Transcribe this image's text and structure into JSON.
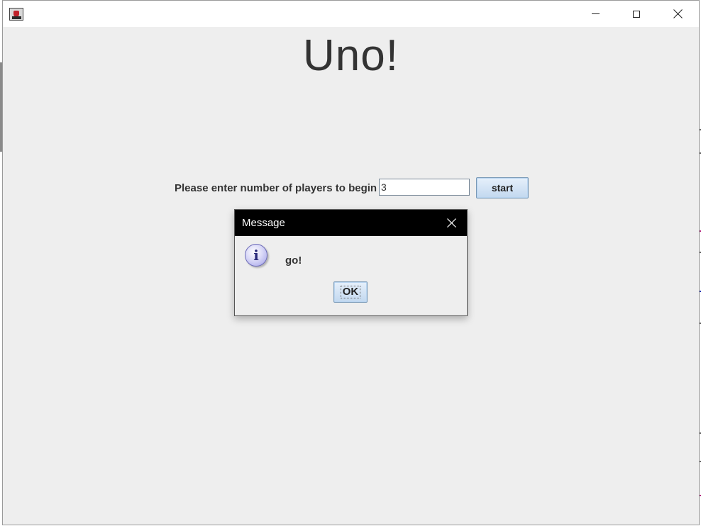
{
  "window": {
    "title": "",
    "icon": "java-cup-icon",
    "controls": [
      "minimize-icon",
      "maximize-icon",
      "close-icon"
    ]
  },
  "main": {
    "heading": "Uno!",
    "players_prompt": "Please enter number of players to begin",
    "players_value": "3",
    "start_label": "start"
  },
  "dialog": {
    "title": "Message",
    "icon": "info-icon",
    "icon_glyph": "i",
    "message": "go!",
    "ok_label": "OK"
  },
  "colors": {
    "window_bg": "#eeeeee",
    "dialog_titlebar": "#000000",
    "button_gradient_top": "#e6f0fb",
    "button_gradient_bottom": "#c2d8ef"
  }
}
